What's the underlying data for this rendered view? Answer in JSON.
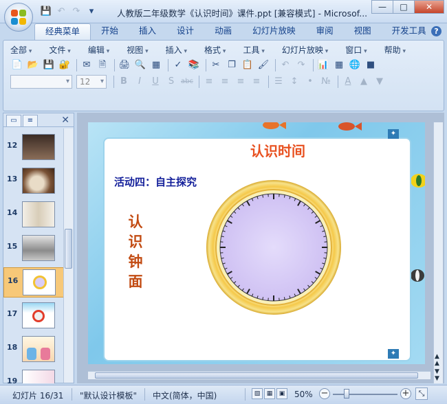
{
  "window": {
    "title": "人教版二年级数学《认识时间》课件.ppt [兼容模式] - Microsof...",
    "minimize": "—",
    "maximize": "□",
    "close": "✕"
  },
  "quick_access": {
    "save_icon": "save-icon",
    "undo_icon": "undo-icon",
    "redo_icon": "redo-icon",
    "customize": "▾"
  },
  "ribbon_tabs": [
    "经典菜单",
    "开始",
    "插入",
    "设计",
    "动画",
    "幻灯片放映",
    "审阅",
    "视图",
    "开发工具"
  ],
  "help": "?",
  "menus": [
    "全部",
    "文件",
    "编辑",
    "视图",
    "插入",
    "格式",
    "工具",
    "幻灯片放映",
    "窗口",
    "帮助"
  ],
  "toolbar": {
    "font_name": "",
    "font_size": "12",
    "bold": "B",
    "italic": "I",
    "underline": "U",
    "shadow": "S",
    "strike": "abc",
    "font_color": "A"
  },
  "thumbnails": [
    {
      "num": "12",
      "selected": false
    },
    {
      "num": "13",
      "selected": false
    },
    {
      "num": "14",
      "selected": false
    },
    {
      "num": "15",
      "selected": false
    },
    {
      "num": "16",
      "selected": true
    },
    {
      "num": "17",
      "selected": false
    },
    {
      "num": "18",
      "selected": false
    },
    {
      "num": "19",
      "selected": false
    }
  ],
  "pane": {
    "close": "✕"
  },
  "slide": {
    "title": "认识时间",
    "activity": "活动四：自主探究",
    "vertical_text": [
      "认",
      "识",
      "钟",
      "面"
    ]
  },
  "status": {
    "slide_pos": "幻灯片 16/31",
    "template": "\"默认设计模板\"",
    "language": "中文(简体，中国)",
    "zoom": "50%",
    "zoom_out": "−",
    "zoom_in": "+"
  },
  "colors": {
    "title_red": "#e8501f",
    "activity_blue": "#131f9a",
    "vertical_orange": "#c24b12",
    "selected_thumb": "#f7c878"
  }
}
